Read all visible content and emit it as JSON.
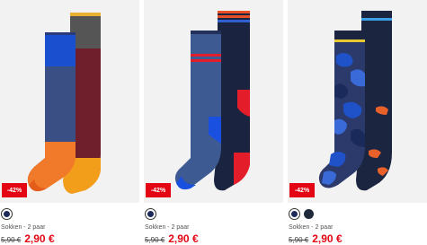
{
  "products": [
    {
      "discount": "-42%",
      "title": "Sokken - 2 paar",
      "old_price": "5,90 €",
      "price": "2,90 €",
      "image": "two-socks-blue-orange-maroon",
      "swatches": [
        "#1e2a5a"
      ],
      "colors": {
        "sale": "#e30613"
      }
    },
    {
      "discount": "-42%",
      "title": "Sokken - 2 paar",
      "old_price": "5,90 €",
      "price": "2,90 €",
      "image": "two-socks-navy-red-stripes",
      "swatches": [
        "#1e2a5a"
      ],
      "colors": {
        "sale": "#e30613"
      }
    },
    {
      "discount": "-42%",
      "title": "Sokken - 2 paar",
      "old_price": "5,90 €",
      "price": "2,90 €",
      "image": "two-socks-camouflage-navy",
      "swatches": [
        "#1e2a5a",
        "#1e2a3a"
      ],
      "colors": {
        "sale": "#e30613"
      }
    }
  ]
}
